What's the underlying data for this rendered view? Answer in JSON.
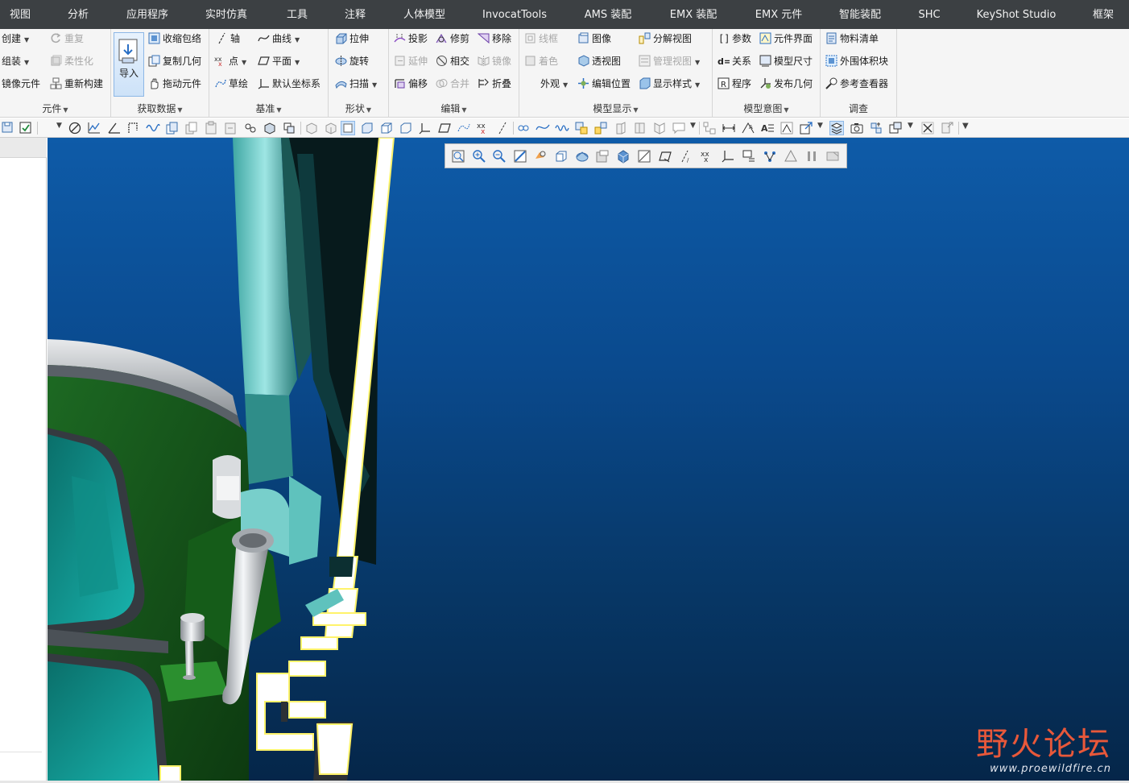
{
  "tabs": [
    "视图",
    "分析",
    "应用程序",
    "实时仿真",
    "工具",
    "注释",
    "人体模型",
    "InvocatTools",
    "AMS 装配",
    "EMX 装配",
    "EMX 元件",
    "智能装配",
    "SHC",
    "KeyShot Studio",
    "框架"
  ],
  "ribbon": {
    "component": {
      "label": "元件",
      "create": "创建",
      "assemble": "组装",
      "mirror_component": "镜像元件",
      "repeat": "重复",
      "flexible": "柔性化",
      "restructure": "重新构建"
    },
    "get_data": {
      "label": "获取数据",
      "import": "导入",
      "shrinkwrap": "收缩包络",
      "copy_geometry": "复制几何",
      "drag_component": "拖动元件"
    },
    "datum": {
      "label": "基准",
      "axis": "轴",
      "curve": "曲线",
      "point": "点",
      "plane": "平面",
      "sketch": "草绘",
      "default_csys": "默认坐标系"
    },
    "shapes": {
      "label": "形状",
      "extrude": "拉伸",
      "revolve": "旋转",
      "sweep": "扫描"
    },
    "editing": {
      "label": "编辑",
      "project": "投影",
      "trim": "修剪",
      "remove": "移除",
      "extend": "延伸",
      "intersect": "相交",
      "mirror": "镜像",
      "offset": "偏移",
      "merge": "合并",
      "fold": "折叠"
    },
    "model_display": {
      "label": "模型显示",
      "wireframe": "线框",
      "color": "着色",
      "appearance": "外观",
      "image": "图像",
      "perspective": "透视图",
      "edit_position": "编辑位置",
      "exploded_view": "分解视图",
      "manage_views": "管理视图",
      "display_style": "显示样式"
    },
    "model_intent": {
      "label": "模型意图",
      "parameters": "参数",
      "relations": "关系",
      "program": "程序",
      "component_interface": "元件界面",
      "model_size": "模型尺寸",
      "publish_geometry": "发布几何"
    },
    "investigate": {
      "label": "调查",
      "bom": "物料清单",
      "bounding_block": "外围体积块",
      "reference_viewer": "参考查看器"
    }
  },
  "watermark": {
    "main": "野火论坛",
    "url": "www.proewildfire.cn"
  },
  "colors": {
    "menubar": "#3c4043",
    "viewport_top": "#0e5ba8",
    "viewport_bottom": "#052649",
    "watermark": "#e8583a"
  }
}
